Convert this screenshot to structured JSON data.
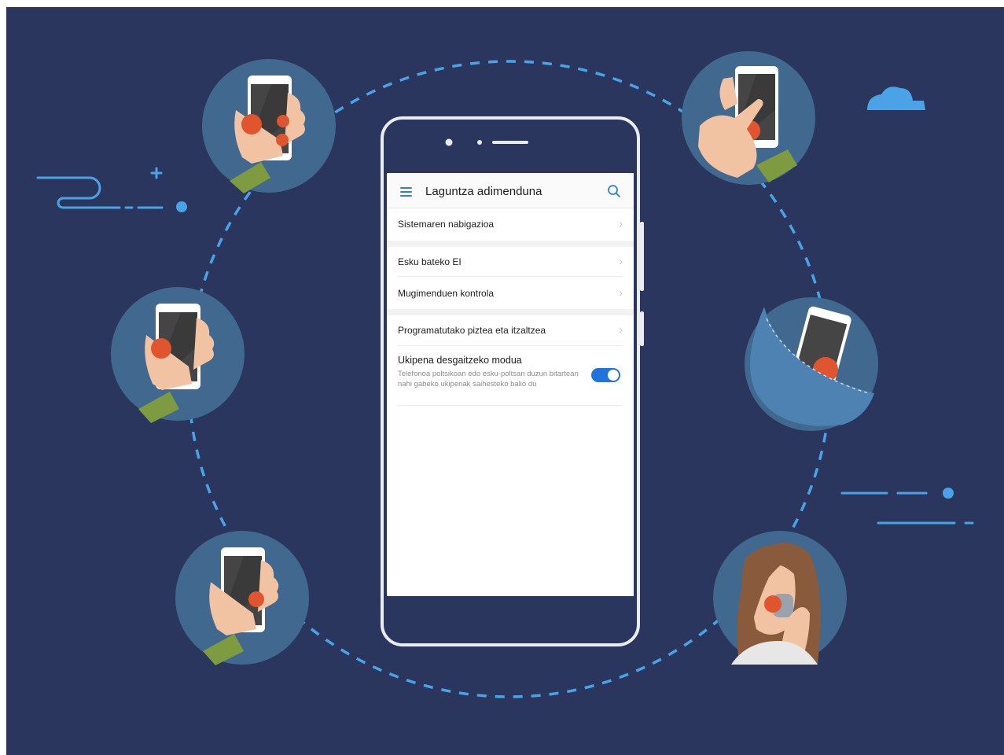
{
  "app": {
    "title": "Laguntza adimenduna"
  },
  "settings": {
    "items": [
      {
        "label": "Sistemaren nabigazioa"
      },
      {
        "label": "Esku bateko EI"
      },
      {
        "label": "Mugimenduen kontrola"
      },
      {
        "label": "Programatutako piztea eta itzaltzea"
      }
    ],
    "toggle_item": {
      "label": "Ukipena desgaitzeko modua",
      "description": "Telefonoa poltsikoan edo esku-poltsan duzun bitartean nahi gabeko ukipenak saihesteko balio du",
      "state": "on"
    }
  },
  "icons": {
    "menu": "hamburger-menu-icon",
    "search": "search-icon",
    "chevron": "chevron-right-icon"
  },
  "colors": {
    "background": "#2b365e",
    "accent": "#2f7fe0",
    "toggle_on": "#1e74dc",
    "circle": "#41698f",
    "dot_orange": "#e0552d",
    "dashed": "#4aa3e6"
  }
}
